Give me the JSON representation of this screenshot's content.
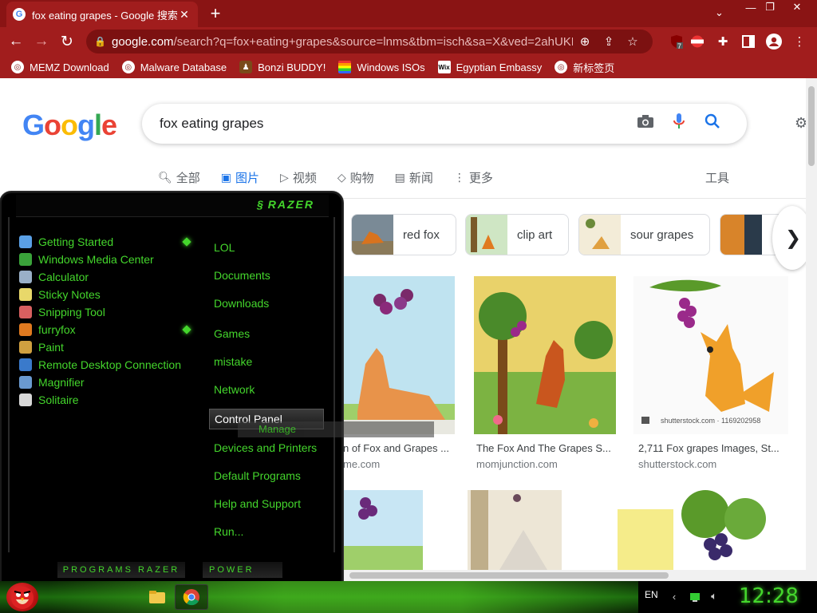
{
  "browser": {
    "tab": {
      "title": "fox eating grapes - Google 搜索",
      "close": "✕"
    },
    "new_tab": "+",
    "tab_menu": "⌄",
    "window_controls": {
      "minimize": "—",
      "maximize": "❐",
      "close": "✕"
    },
    "nav": {
      "back": "←",
      "forward": "→",
      "reload": "↻"
    },
    "url_host": "google.com",
    "url_path": "/search?q=fox+eating+grapes&source=lnms&tbm=isch&sa=X&ved=2ahUKEw...",
    "extension_badge": "7",
    "bookmarks": [
      {
        "label": "MEMZ Download"
      },
      {
        "label": "Malware Database"
      },
      {
        "label": "Bonzi BUDDY!"
      },
      {
        "label": "Windows ISOs"
      },
      {
        "label": "Egyptian Embassy"
      },
      {
        "label": "新标签页"
      }
    ]
  },
  "google": {
    "search_query": "fox eating grapes",
    "tabs": [
      {
        "label": "全部",
        "icon": "search-icon"
      },
      {
        "label": "图片",
        "icon": "image-icon"
      },
      {
        "label": "视频",
        "icon": "video-icon"
      },
      {
        "label": "购物",
        "icon": "tag-icon"
      },
      {
        "label": "新闻",
        "icon": "news-icon"
      },
      {
        "label": "更多",
        "icon": "more-icon"
      }
    ],
    "tools": "工具",
    "chips": [
      {
        "label": "red fox"
      },
      {
        "label": "clip art"
      },
      {
        "label": "sour grapes"
      }
    ],
    "results": [
      {
        "caption": "n of Fox and Grapes ...",
        "source": "me.com"
      },
      {
        "caption": "The Fox And The Grapes S...",
        "source": "momjunction.com"
      },
      {
        "caption": "2,711 Fox grapes Images, St...",
        "source": "shutterstock.com",
        "watermark": "shutterstock.com · 1169202958"
      }
    ]
  },
  "startmenu": {
    "brand": "RAZER",
    "programs": [
      {
        "label": "Getting Started",
        "icon_color": "#5aa0e6",
        "new": true
      },
      {
        "label": "Windows Media Center",
        "icon_color": "#3aa33a",
        "new": false
      },
      {
        "label": "Calculator",
        "icon_color": "#9ab0c8",
        "new": false
      },
      {
        "label": "Sticky Notes",
        "icon_color": "#e8d86a",
        "new": false
      },
      {
        "label": "Snipping Tool",
        "icon_color": "#d86060",
        "new": false
      },
      {
        "label": "furryfox",
        "icon_color": "#e07a20",
        "new": true
      },
      {
        "label": "Paint",
        "icon_color": "#d0a040",
        "new": false
      },
      {
        "label": "Remote Desktop Connection",
        "icon_color": "#3a7acb",
        "new": false
      },
      {
        "label": "Magnifier",
        "icon_color": "#6a9ad0",
        "new": false
      },
      {
        "label": "Solitaire",
        "icon_color": "#d8d8d8",
        "new": false
      }
    ],
    "places": [
      {
        "label": "LOL",
        "highlighted": false
      },
      {
        "label": "Documents",
        "highlighted": false
      },
      {
        "label": "Downloads",
        "highlighted": false
      },
      {
        "label": "Games",
        "highlighted": false
      },
      {
        "label": "mistake",
        "highlighted": false
      },
      {
        "label": "Network",
        "highlighted": false
      },
      {
        "label": "Control Panel",
        "highlighted": true
      },
      {
        "label": "Devices and Printers",
        "highlighted": false
      },
      {
        "label": "Default Programs",
        "highlighted": false
      },
      {
        "label": "Help and Support",
        "highlighted": false
      },
      {
        "label": "Run...",
        "highlighted": false
      }
    ],
    "drag_ghost": "Manage",
    "programs_button": "PROGRAMS RAZER",
    "power_button": "POWER"
  },
  "taskbar": {
    "language": "EN",
    "clock": "12:28"
  },
  "colors": {
    "accent_green": "#44d62c",
    "chrome_red": "#a11d1d"
  }
}
